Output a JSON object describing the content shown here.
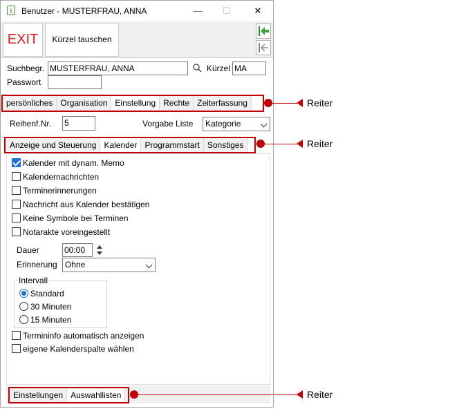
{
  "window": {
    "title": "Benutzer - MUSTERFRAU, ANNA",
    "app_icon_glyph": "§",
    "minimize_glyph": "—",
    "maximize_glyph": "☐",
    "close_glyph": "✕"
  },
  "toolbar": {
    "exit_label": "EXIT",
    "swap_label": "Kürzel tauschen",
    "nav_first_icon": "arrow-left-to-line-icon",
    "nav_prev_icon": "arrow-left-to-line-gray-icon",
    "accent_green": "#3aa53a",
    "exit_color": "#e0181f"
  },
  "search": {
    "label": "Suchbegr.",
    "value": "MUSTERFRAU, ANNA",
    "kuerzel_label": "Kürzel",
    "kuerzel_value": "MA",
    "password_label": "Passwort",
    "password_value": ""
  },
  "main_tabs": [
    "persönliches",
    "Organisation",
    "Einstellung",
    "Rechte",
    "Zeiterfassung"
  ],
  "main_tab_active": "Einstellung",
  "settings": {
    "reihenf_label": "Reihenf.Nr.",
    "reihenf_value": "5",
    "vorgabe_label": "Vorgabe Liste",
    "vorgabe_value": "Kategorie"
  },
  "sub_tabs": [
    "Anzeige und Steuerung",
    "Kalender",
    "Programmstart",
    "Sonstiges"
  ],
  "sub_tab_active": "Kalender",
  "checkboxes_top": [
    {
      "label": "Kalender mit dynam. Memo",
      "checked": true
    },
    {
      "label": "Kalendernachrichten",
      "checked": false
    },
    {
      "label": "Terminerinnerungen",
      "checked": false
    },
    {
      "label": "Nachricht aus Kalender bestätigen",
      "checked": false
    },
    {
      "label": "Keine Symbole bei Terminen",
      "checked": false
    },
    {
      "label": "Notarakte voreingestellt",
      "checked": false
    }
  ],
  "dauer": {
    "label": "Dauer",
    "value": "00:00"
  },
  "erinnerung": {
    "label": "Erinnerung",
    "value": "Ohne"
  },
  "intervall": {
    "label": "Intervall",
    "options": [
      {
        "label": "Standard",
        "checked": true
      },
      {
        "label": "30 Minuten",
        "checked": false
      },
      {
        "label": "15 Minuten",
        "checked": false
      }
    ]
  },
  "checkboxes_bottom": [
    {
      "label": "Termininfo automatisch anzeigen",
      "checked": false
    },
    {
      "label": "eigene Kalenderspalte wählen",
      "checked": false
    }
  ],
  "bottom_tabs": [
    "Einstellungen",
    "Auswahllisten"
  ],
  "bottom_tab_active": "Auswahllisten",
  "callouts": [
    "Reiter",
    "Reiter",
    "Reiter"
  ],
  "callout_color": "#c00000"
}
